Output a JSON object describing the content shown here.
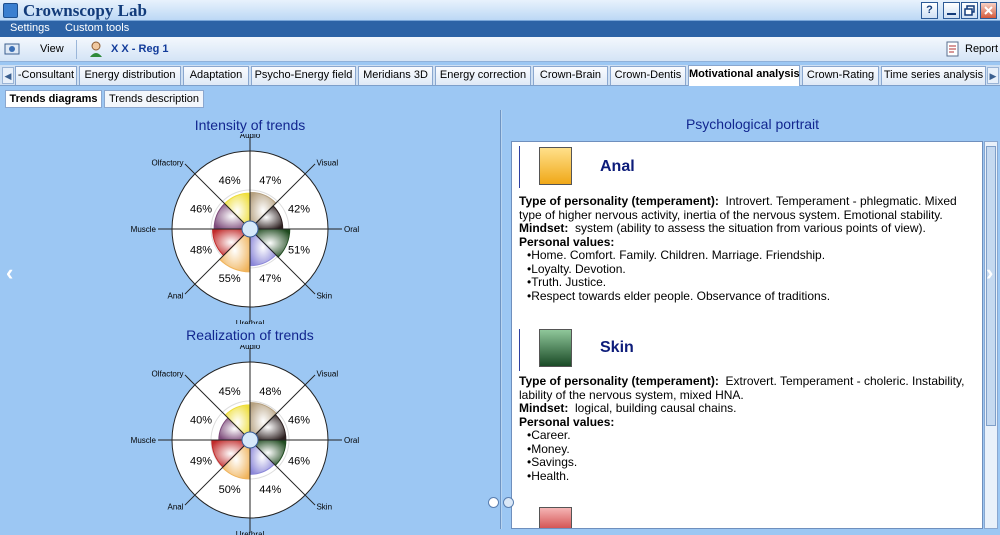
{
  "window": {
    "title": "Crownscopy Lab",
    "help_label": "?"
  },
  "menu": [
    "Settings",
    "Custom tools"
  ],
  "toolbar": {
    "view_label": "View",
    "user_label": "X X  - Reg 1",
    "report_label": "Report"
  },
  "tabs": [
    {
      "label": "-Consultant",
      "active": false
    },
    {
      "label": "Energy distribution",
      "active": false
    },
    {
      "label": "Adaptation",
      "active": false
    },
    {
      "label": "Psycho-Energy field",
      "active": false
    },
    {
      "label": "Meridians 3D",
      "active": false
    },
    {
      "label": "Energy correction",
      "active": false
    },
    {
      "label": "Crown-Brain",
      "active": false
    },
    {
      "label": "Crown-Dentis",
      "active": false
    },
    {
      "label": "Motivational analysis",
      "active": true
    },
    {
      "label": "Crown-Rating",
      "active": false
    },
    {
      "label": "Time series analysis",
      "active": false
    }
  ],
  "subtabs": [
    {
      "label": "Trends diagrams",
      "active": true
    },
    {
      "label": "Trends description",
      "active": false
    }
  ],
  "chart_data": [
    {
      "type": "pie",
      "title": "Intensity of trends",
      "categories": [
        "Visual",
        "Oral",
        "Skin",
        "Urethral",
        "Anal",
        "Muscle",
        "Olfactory",
        "Audio"
      ],
      "values": [
        47,
        42,
        51,
        47,
        55,
        48,
        46,
        46
      ],
      "labels": [
        "47%",
        "42%",
        "51%",
        "47%",
        "55%",
        "48%",
        "46%",
        "46%"
      ],
      "colors": [
        "#b5a07f",
        "#2a1d1d",
        "#1f4a1f",
        "#8a86d8",
        "#f0b35a",
        "#c12b2b",
        "#7d4a7a",
        "#eede3a"
      ]
    },
    {
      "type": "pie",
      "title": "Realization of trends",
      "categories": [
        "Visual",
        "Oral",
        "Skin",
        "Urethral",
        "Anal",
        "Muscle",
        "Olfactory",
        "Audio"
      ],
      "values": [
        48,
        46,
        46,
        44,
        50,
        49,
        40,
        45
      ],
      "labels": [
        "48%",
        "46%",
        "46%",
        "44%",
        "50%",
        "49%",
        "40%",
        "45%"
      ],
      "colors": [
        "#b5a07f",
        "#2a1d1d",
        "#1f4a1f",
        "#8a86d8",
        "#f0b35a",
        "#c12b2b",
        "#7d4a7a",
        "#eede3a"
      ]
    }
  ],
  "portrait": {
    "title": "Psychological portrait",
    "sections": [
      {
        "name": "Anal",
        "color": "#f0a818",
        "type_label": "Type of personality (temperament):",
        "type_text": "Introvert. Temperament - phlegmatic. Mixed type of higher nervous activity, inertia of the nervous system. Emotional stability.",
        "mindset_label": "Mindset:",
        "mindset_text": "system (ability to assess the situation from various points of view).",
        "values_label": "Personal values:",
        "values": [
          "Home. Comfort. Family. Children. Marriage. Friendship.",
          "Loyalty. Devotion.",
          "Truth. Justice.",
          "Respect towards elder people. Observance of traditions."
        ]
      },
      {
        "name": "Skin",
        "color": "#1a4a26",
        "type_label": "Type of personality (temperament):",
        "type_text": "Extrovert. Temperament - choleric. Instability, lability of the nervous system, mixed HNA.",
        "mindset_label": "Mindset:",
        "mindset_text": "logical, building causal chains.",
        "values_label": "Personal values:",
        "values": [
          "Career.",
          "Money.",
          "Savings.",
          "Health."
        ]
      }
    ],
    "third_color": "#c83030"
  }
}
